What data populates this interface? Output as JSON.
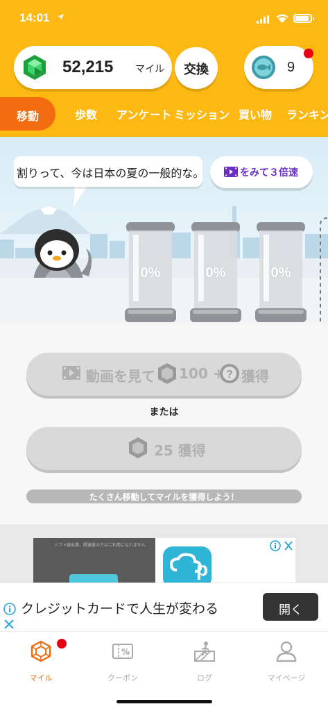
{
  "status_bar": {
    "time": "14:01"
  },
  "header": {
    "miles_value": "52,215",
    "miles_unit": "マイル",
    "exchange_label": "交換",
    "coin_count": "9"
  },
  "tabs": [
    {
      "label": "移動",
      "active": true
    },
    {
      "label": "歩数"
    },
    {
      "label": "アンケート",
      "badge": true
    },
    {
      "label": "ミッション"
    },
    {
      "label": "買い物"
    },
    {
      "label": "ランキン"
    }
  ],
  "speech_bubble_text": "割りって、今は日本の夏の一般的な。",
  "speed_button_label": "をみて３倍速",
  "jars": [
    "0%",
    "0%",
    "0%"
  ],
  "actions": {
    "video_button": {
      "text1": "動画を見て",
      "text2": "100 +",
      "text3": "獲得"
    },
    "or_text": "または",
    "plain_button": {
      "text1": "25 獲得"
    },
    "hint": "たくさん移動してマイルを獲得しよう！"
  },
  "ad": {
    "small_text": "ソフト銀本業、関連者の方はご利用になれません",
    "banner_text": "クレジットカードで人生が変わる",
    "open_label": "開く"
  },
  "bottom_nav": [
    {
      "label": "マイル",
      "active": true,
      "icon": "miles-icon"
    },
    {
      "label": "クーポン",
      "icon": "coupon-icon"
    },
    {
      "label": "ログ",
      "icon": "log-icon"
    },
    {
      "label": "マイページ",
      "icon": "mypage-icon"
    }
  ],
  "colors": {
    "header": "#fdb813",
    "active_tab": "#f26b0f",
    "badge": "#e60012",
    "speed_text": "#6a2fc5"
  }
}
